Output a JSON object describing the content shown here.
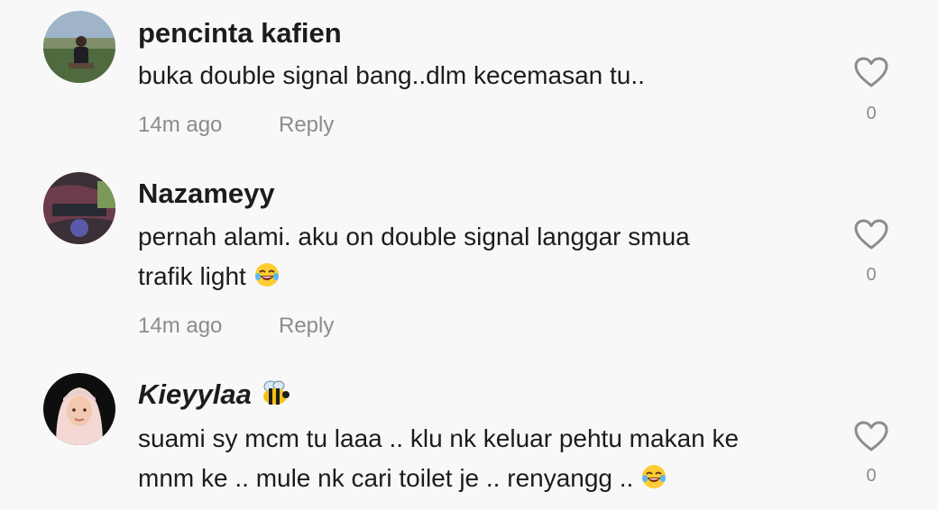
{
  "comments": [
    {
      "username": "pencinta kafien",
      "text": "buka double signal bang..dlm kecemasan tu..",
      "time": "14m ago",
      "reply": "Reply",
      "likes": "0",
      "avatar_colors": [
        "#7a8ea0",
        "#3c4a32"
      ]
    },
    {
      "username": "Nazameyy",
      "text_line1": "pernah alami. aku on double signal langgar smua",
      "text_line2": "trafik light",
      "emoji": "laughing-tears-emoji",
      "time": "14m ago",
      "reply": "Reply",
      "likes": "0",
      "avatar_colors": [
        "#6b3d4a",
        "#2e2e3a"
      ]
    },
    {
      "username": "Kieyylaa",
      "username_emoji": "bee-emoji",
      "text_line1": "suami sy mcm tu laaa .. klu nk keluar pehtu makan ke",
      "text_line2": "mnm ke .. mule nk cari toilet je .. renyangg ..",
      "emoji": "laughing-tears-emoji",
      "likes": "0",
      "avatar_colors": [
        "#111111",
        "#f0d8d0"
      ]
    }
  ]
}
